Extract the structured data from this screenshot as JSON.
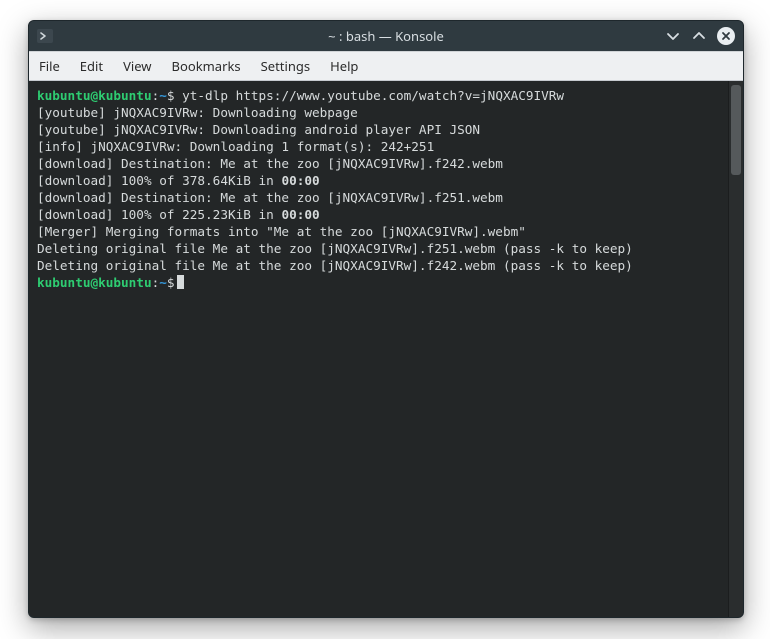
{
  "window": {
    "title": "~ : bash — Konsole"
  },
  "menubar": {
    "items": [
      "File",
      "Edit",
      "View",
      "Bookmarks",
      "Settings",
      "Help"
    ]
  },
  "prompt": {
    "user_host": "kubuntu@kubuntu",
    "colon": ":",
    "path": "~",
    "dollar": "$"
  },
  "command1": " yt-dlp https://www.youtube.com/watch?v=jNQXAC9IVRw",
  "output": {
    "l1": "[youtube] jNQXAC9IVRw: Downloading webpage",
    "l2": "[youtube] jNQXAC9IVRw: Downloading android player API JSON",
    "l3": "[info] jNQXAC9IVRw: Downloading 1 format(s): 242+251",
    "l4": "[download] Destination: Me at the zoo [jNQXAC9IVRw].f242.webm",
    "l5a": "[download] 100% of 378.64KiB in ",
    "l5b": "00:00",
    "l6": "[download] Destination: Me at the zoo [jNQXAC9IVRw].f251.webm",
    "l7a": "[download] 100% of 225.23KiB in ",
    "l7b": "00:00",
    "l8": "[Merger] Merging formats into \"Me at the zoo [jNQXAC9IVRw].webm\"",
    "l9": "Deleting original file Me at the zoo [jNQXAC9IVRw].f251.webm (pass -k to keep)",
    "l10": "Deleting original file Me at the zoo [jNQXAC9IVRw].f242.webm (pass -k to keep)"
  }
}
